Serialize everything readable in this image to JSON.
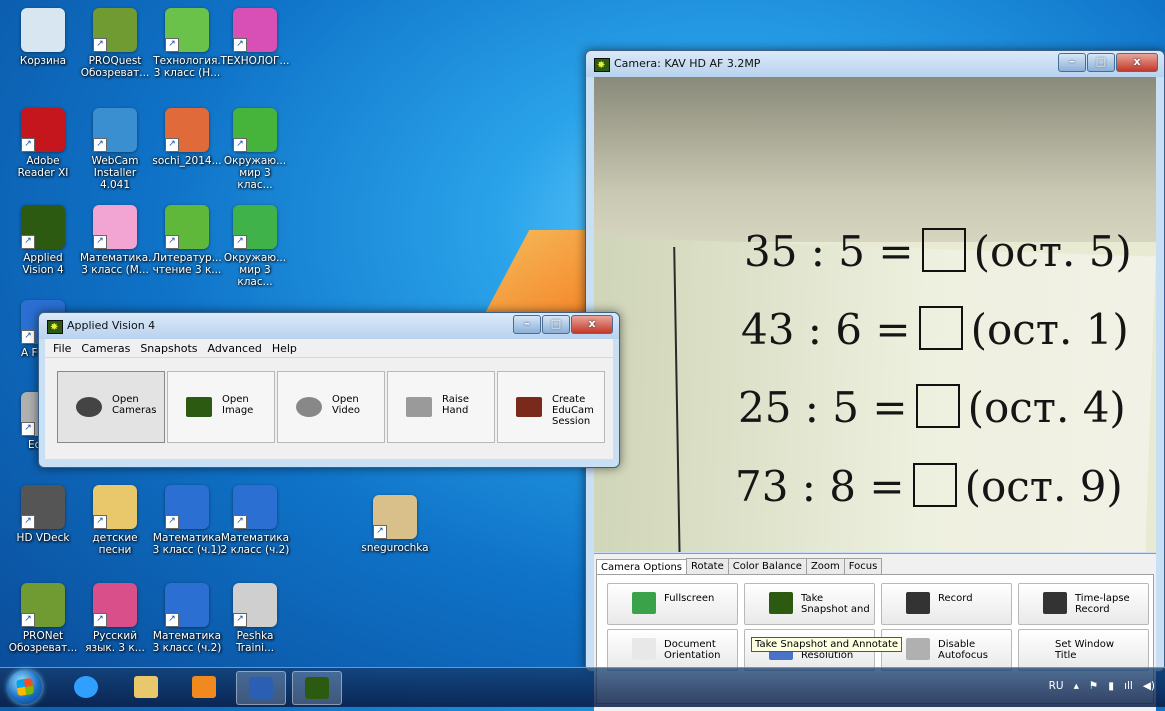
{
  "desktop": {
    "icons": [
      {
        "label": "Корзина",
        "icon": "recycle-bin-icon",
        "color": "#d8e6f2"
      },
      {
        "label": "PROQuest Обозреват...",
        "icon": "book-icon",
        "color": "#6f9b32"
      },
      {
        "label": "Технология. 3 класс (Н...",
        "icon": "tech-3-icon",
        "color": "#6bc24a"
      },
      {
        "label": "ТЕХНОЛОГ...",
        "icon": "scissors-icon",
        "color": "#d84fb5"
      },
      {
        "label": "Adobe Reader XI",
        "icon": "adobe-reader-icon",
        "color": "#c4161c"
      },
      {
        "label": "WebCam Installer 4.041",
        "icon": "webcam-icon",
        "color": "#3a8fd0"
      },
      {
        "label": "sochi_2014...",
        "icon": "powerpoint-file-icon",
        "color": "#e06a3a"
      },
      {
        "label": "Окружаю... мир 3 клас...",
        "icon": "fish-icon",
        "color": "#46b43a"
      },
      {
        "label": "Applied Vision 4",
        "icon": "applied-vision-icon",
        "color": "#2c5a10"
      },
      {
        "label": "Математика. 3 класс (М...",
        "icon": "math-3-icon",
        "color": "#f2a4d2"
      },
      {
        "label": "Литератур... чтение 3 к...",
        "icon": "literature-icon",
        "color": "#5fb83a"
      },
      {
        "label": "Окружаю... мир 3 клас...",
        "icon": "kids-icon",
        "color": "#3fb24a"
      },
      {
        "label": "HD VDeck",
        "icon": "hd-vdeck-icon",
        "color": "#555555"
      },
      {
        "label": "детские песни",
        "icon": "folder-icon",
        "color": "#e8c86a"
      },
      {
        "label": "Математика 3 класс (ч.1)",
        "icon": "math-2-5-icon",
        "color": "#2a6fd1"
      },
      {
        "label": "Математика 2 класс (ч.2)",
        "icon": "math-a-icon",
        "color": "#2a6fd1"
      },
      {
        "label": "snegurochka",
        "icon": "powerpoint-file-icon",
        "color": "#d9c08a"
      },
      {
        "label": "PRONet Обозреват...",
        "icon": "book-icon",
        "color": "#6f9b32"
      },
      {
        "label": "Русский язык. 3 к...",
        "icon": "russian-3-icon",
        "color": "#d84f8a"
      },
      {
        "label": "Математика 3 класс (ч.2)",
        "icon": "math-a-icon",
        "color": "#2a6fd1"
      },
      {
        "label": "Peshka Traini...",
        "icon": "chess-pawn-icon",
        "color": "#cfcfcf"
      },
      {
        "label": "A Fulls...",
        "icon": "fullscreen-app-icon",
        "color": "#2a6fd1"
      },
      {
        "label": "Edu...",
        "icon": "educam-icon",
        "color": "#b0b0b0"
      }
    ]
  },
  "camera_window": {
    "title": "Camera: KAV HD AF 3.2MP",
    "controls": {
      "minimize": "–",
      "maximize": "□",
      "close": "x"
    },
    "view_text": [
      {
        "expr": "35 : 5 =",
        "rest": "(ост. 5)"
      },
      {
        "expr": "43 : 6 =",
        "rest": "(ост. 1)"
      },
      {
        "expr": "25 : 5 =",
        "rest": "(ост. 4)"
      },
      {
        "expr": "73 : 8 =",
        "rest": "(ост. 9)"
      }
    ],
    "tabs": [
      "Camera Options",
      "Rotate",
      "Color Balance",
      "Zoom",
      "Focus"
    ],
    "buttons": [
      {
        "label": "Fullscreen",
        "icon": "fullscreen-icon",
        "color": "#3aa34a"
      },
      {
        "label": "Take Snapshot and",
        "icon": "snapshot-annotate-icon",
        "color": "#2c5a10"
      },
      {
        "label": "Record",
        "icon": "clapperboard-icon",
        "color": "#333333"
      },
      {
        "label": "Time-lapse Record",
        "icon": "time-lapse-icon",
        "color": "#333333"
      },
      {
        "label": "Document Orientation",
        "icon": "document-orientation-icon",
        "color": "#e8e8e8"
      },
      {
        "label": "Camera Resolution",
        "icon": "camera-resolution-icon",
        "color": "#4a72c8"
      },
      {
        "label": "Disable Autofocus",
        "icon": "disable-autofocus-icon",
        "color": "#b0b0b0"
      },
      {
        "label": "Set Window Title",
        "icon": "",
        "color": ""
      }
    ],
    "tooltip": "Take Snapshot and Annotate"
  },
  "av_window": {
    "title": "Applied Vision 4",
    "menu": [
      "File",
      "Cameras",
      "Snapshots",
      "Advanced",
      "Help"
    ],
    "buttons": [
      {
        "label": "Open Cameras",
        "icon": "webcam-icon"
      },
      {
        "label": "Open Image",
        "icon": "image-icon"
      },
      {
        "label": "Open Video",
        "icon": "video-reel-icon"
      },
      {
        "label": "Raise Hand",
        "icon": "raise-hand-icon"
      },
      {
        "label": "Create EduCam Session",
        "icon": "educam-session-icon"
      }
    ]
  },
  "taskbar": {
    "apps": [
      "internet-explorer-icon",
      "file-explorer-icon",
      "media-player-icon",
      "word-icon",
      "applied-vision-icon"
    ],
    "tray": {
      "lang": "RU",
      "up_arrow": "▴",
      "flag": "⚑",
      "battery": "▮",
      "signal": "ıll",
      "volume": "◀)"
    }
  },
  "colors": {
    "accent": "#0f73c8",
    "tooltip_bg": "#ffffe1",
    "window_frame": "#c9dff3"
  }
}
